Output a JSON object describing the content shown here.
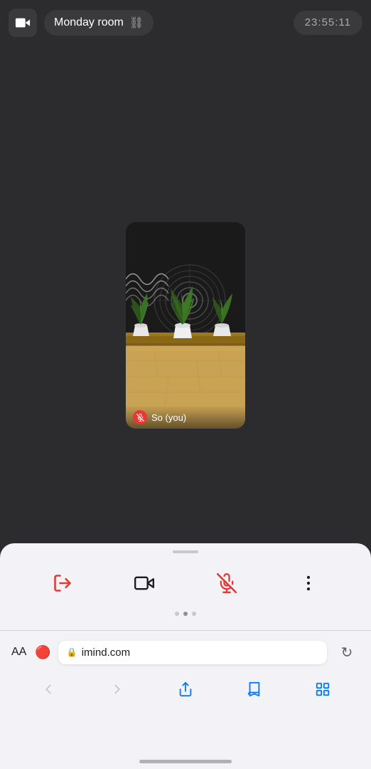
{
  "header": {
    "room_name": "Monday room",
    "timer": "23:55:11",
    "camera_label": "camera",
    "link_label": "link"
  },
  "video": {
    "user_name": "So  (you)",
    "mic_muted": true
  },
  "toolbar": {
    "leave_label": "leave",
    "camera_label": "camera-toggle",
    "mute_label": "mute",
    "more_label": "more-options"
  },
  "page_dots": {
    "active_index": 1,
    "count": 3
  },
  "safari": {
    "aa_label": "AA",
    "url": "imind.com",
    "lock_label": "secure",
    "reload_label": "reload",
    "back_label": "back",
    "forward_label": "forward",
    "share_label": "share",
    "bookmarks_label": "bookmarks",
    "tabs_label": "tabs"
  }
}
